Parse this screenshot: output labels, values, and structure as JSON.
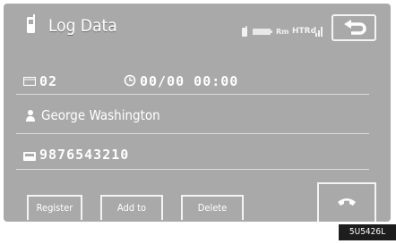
{
  "header": {
    "title": "Log Data",
    "status": {
      "signal_label": "HTRd",
      "roaming_label": "Rm"
    },
    "back_icon": "return-arrow-icon"
  },
  "entry": {
    "id": "02",
    "datetime": "00/00 00:00",
    "name": "George Washington",
    "number": "9876543210"
  },
  "softkeys": {
    "register": "Register",
    "add_to": "Add to",
    "delete": "Delete"
  },
  "call_icon": "handset-icon",
  "ref_code": "5U5426L",
  "colors": {
    "screen": "#a9a9a9",
    "text": "#ffffff",
    "rule": "#dcdcdc"
  }
}
